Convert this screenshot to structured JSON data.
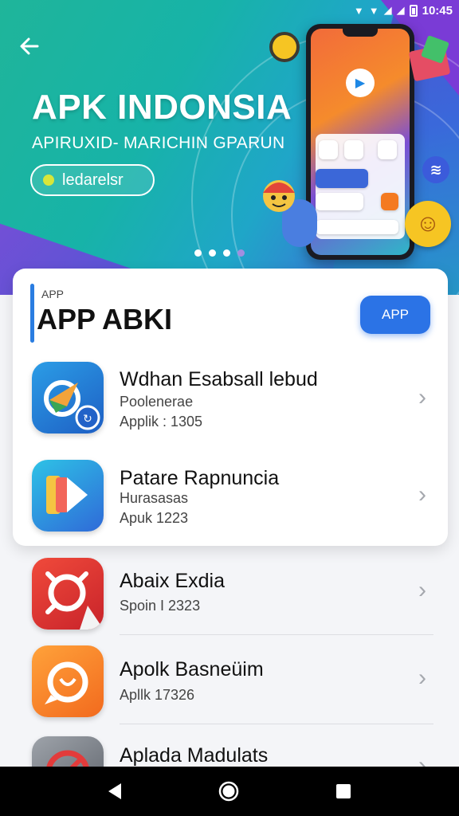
{
  "status_bar": {
    "time": "10:45"
  },
  "hero": {
    "title": "APK INDONSIA",
    "subtitle": "APIRUXID- MARICHIN GPARUN",
    "chip_label": "ledarelsr",
    "page_dots": 4,
    "active_dot": 3
  },
  "featured": {
    "kicker": "APP",
    "title": "APP ABKI",
    "button_label": "APP"
  },
  "apps": [
    {
      "name": "Wdhan Esabsall lebud",
      "subtitle": "Poolenerae",
      "meta": "Applik : 1305"
    },
    {
      "name": "Patare Rapnuncia",
      "subtitle": "Hurasasas",
      "meta": "Apuk 1223"
    },
    {
      "name": "Abaix Exdia",
      "subtitle": "",
      "meta": "Spoin I 2323"
    },
    {
      "name": "Apolk Basneüim",
      "subtitle": "",
      "meta": "Apllk 17326"
    },
    {
      "name": "Aplada Madulats",
      "subtitle": "",
      "meta": ""
    }
  ],
  "colors": {
    "accent": "#2b73e6",
    "hero_start": "#1fb59a",
    "hero_end": "#5a3fc4"
  },
  "icons": {
    "back": "arrow-left-icon",
    "chevron": "chevron-right-icon",
    "nav": [
      "nav-back-icon",
      "nav-home-icon",
      "nav-recents-icon"
    ]
  }
}
